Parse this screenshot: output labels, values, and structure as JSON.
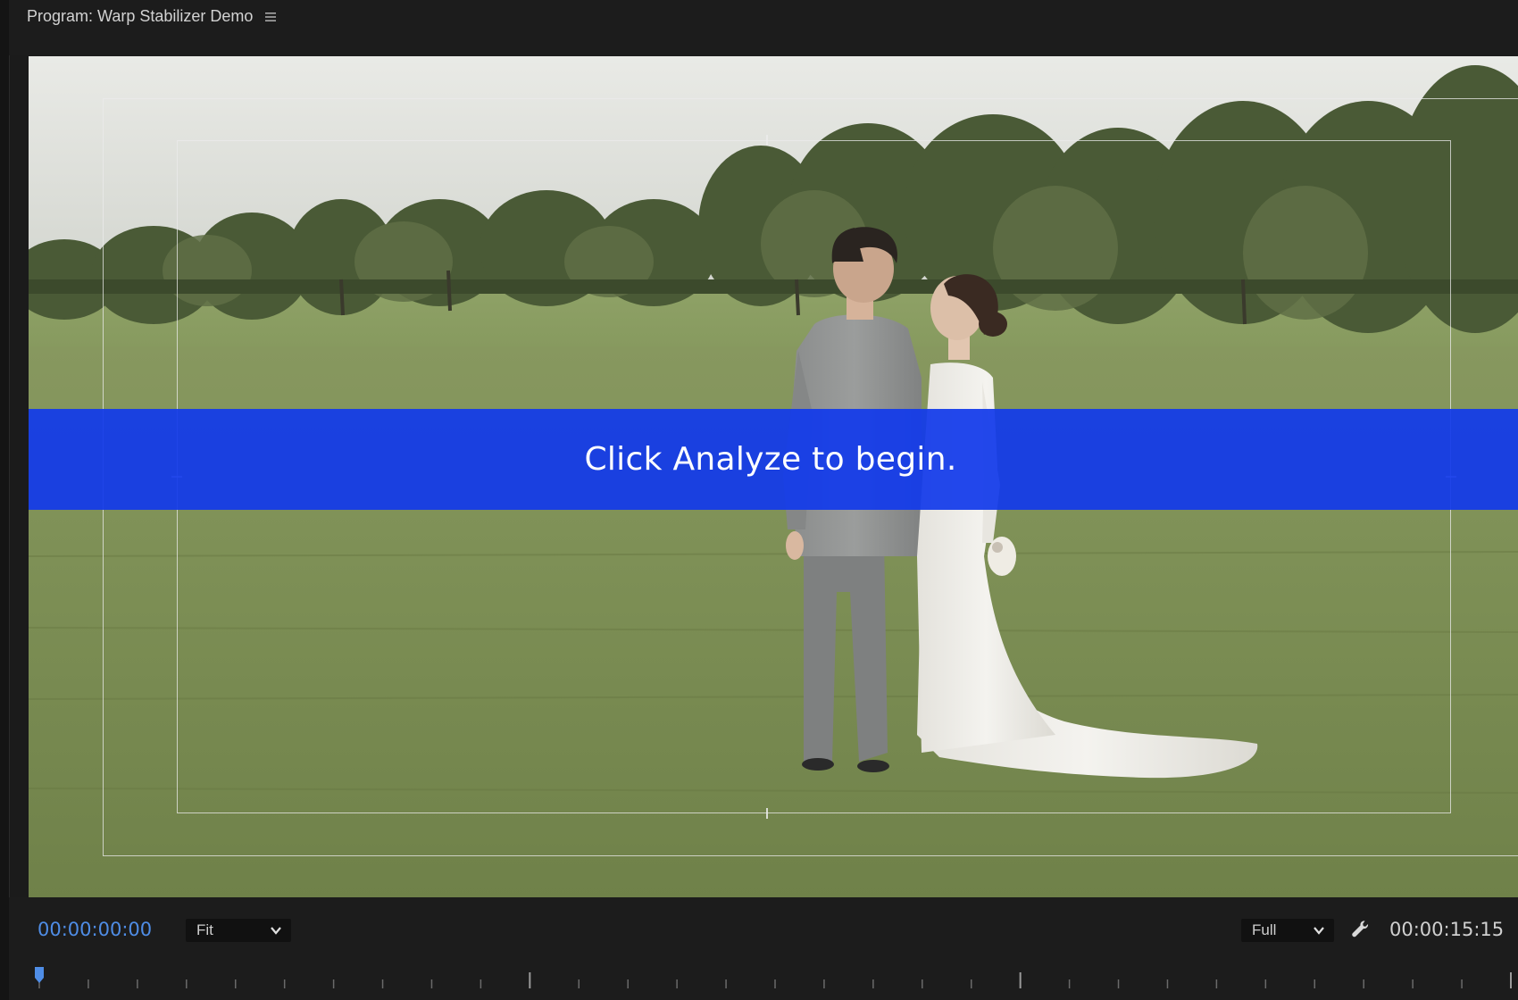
{
  "panel": {
    "title": "Program: Warp Stabilizer Demo",
    "menu_icon": "hamburger-menu-icon"
  },
  "viewer": {
    "overlay_message": "Click Analyze to begin.",
    "overlay_color": "#123aeb"
  },
  "controls": {
    "current_timecode": "00:00:00:00",
    "zoom_level": "Fit",
    "playback_resolution": "Full",
    "settings_icon": "wrench-icon",
    "duration_timecode": "00:00:15:15",
    "accent_color": "#4f8de6"
  },
  "timeline": {
    "playhead_position": 0
  }
}
